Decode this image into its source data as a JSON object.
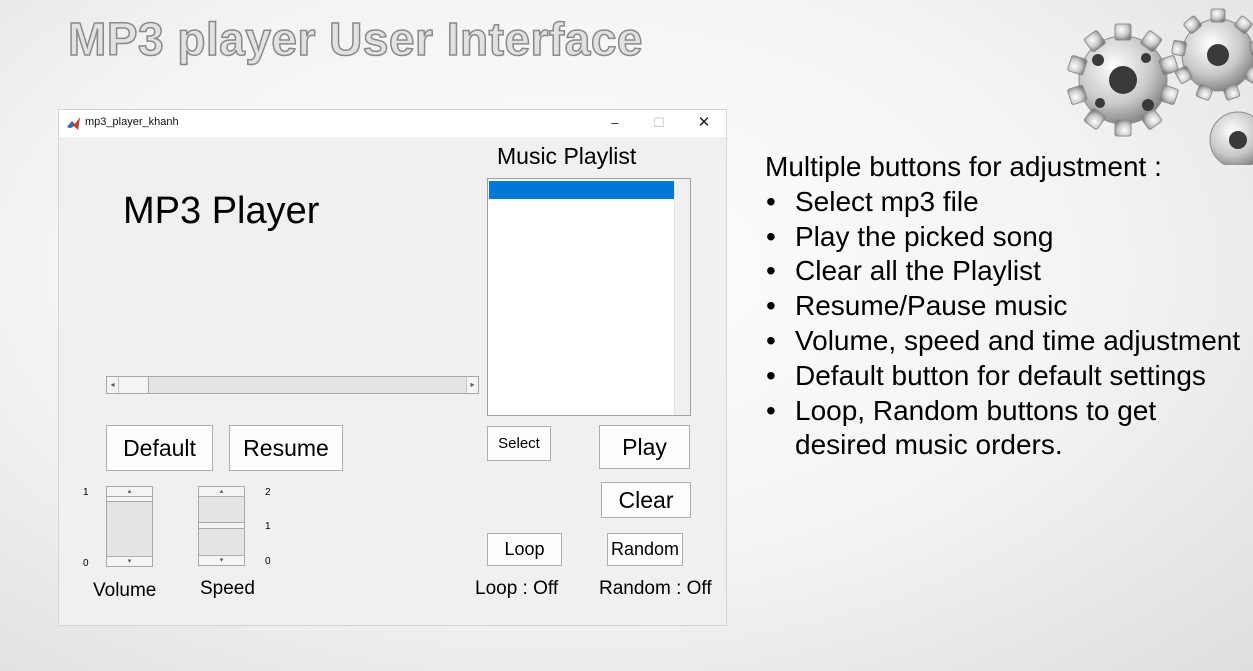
{
  "slide": {
    "title": "MP3 player User Interface",
    "description_heading": "Multiple buttons for adjustment :",
    "bullets": [
      "Select mp3 file",
      "Play the picked song",
      "Clear all the Playlist",
      "Resume/Pause music",
      "Volume, speed and time adjustment",
      "Default button for default settings",
      "Loop, Random buttons to get desired music orders."
    ],
    "bullet_glyph": "•"
  },
  "window": {
    "title": "mp3_player_khanh",
    "controls": {
      "minimize": "–",
      "maximize": "☐",
      "close": "✕"
    },
    "app_icon": "matlab-icon"
  },
  "player": {
    "heading": "MP3 Player",
    "playlist_heading": "Music Playlist",
    "playlist_items": [
      ""
    ],
    "selected_index": 0,
    "time_slider": {
      "value_fraction": 0.0,
      "left_arrow": "◂",
      "right_arrow": "▸"
    },
    "buttons": {
      "default": "Default",
      "resume": "Resume",
      "select": "Select",
      "play": "Play",
      "clear": "Clear",
      "loop": "Loop",
      "random": "Random"
    },
    "volume": {
      "label": "Volume",
      "max_tick": "1",
      "min_tick": "0",
      "value_fraction": 1.0
    },
    "speed": {
      "label": "Speed",
      "max_tick": "2",
      "mid_tick": "1",
      "min_tick": "0",
      "value_fraction": 0.5
    },
    "slider_arrows": {
      "up": "▴",
      "down": "▾"
    },
    "loop_status": "Loop : Off",
    "random_status": "Random : Off"
  },
  "colors": {
    "selection": "#0078d7",
    "window_bg": "#f0f0f0",
    "title_text_fill": "#e2e2e2",
    "title_text_stroke": "#8a8a8a"
  }
}
